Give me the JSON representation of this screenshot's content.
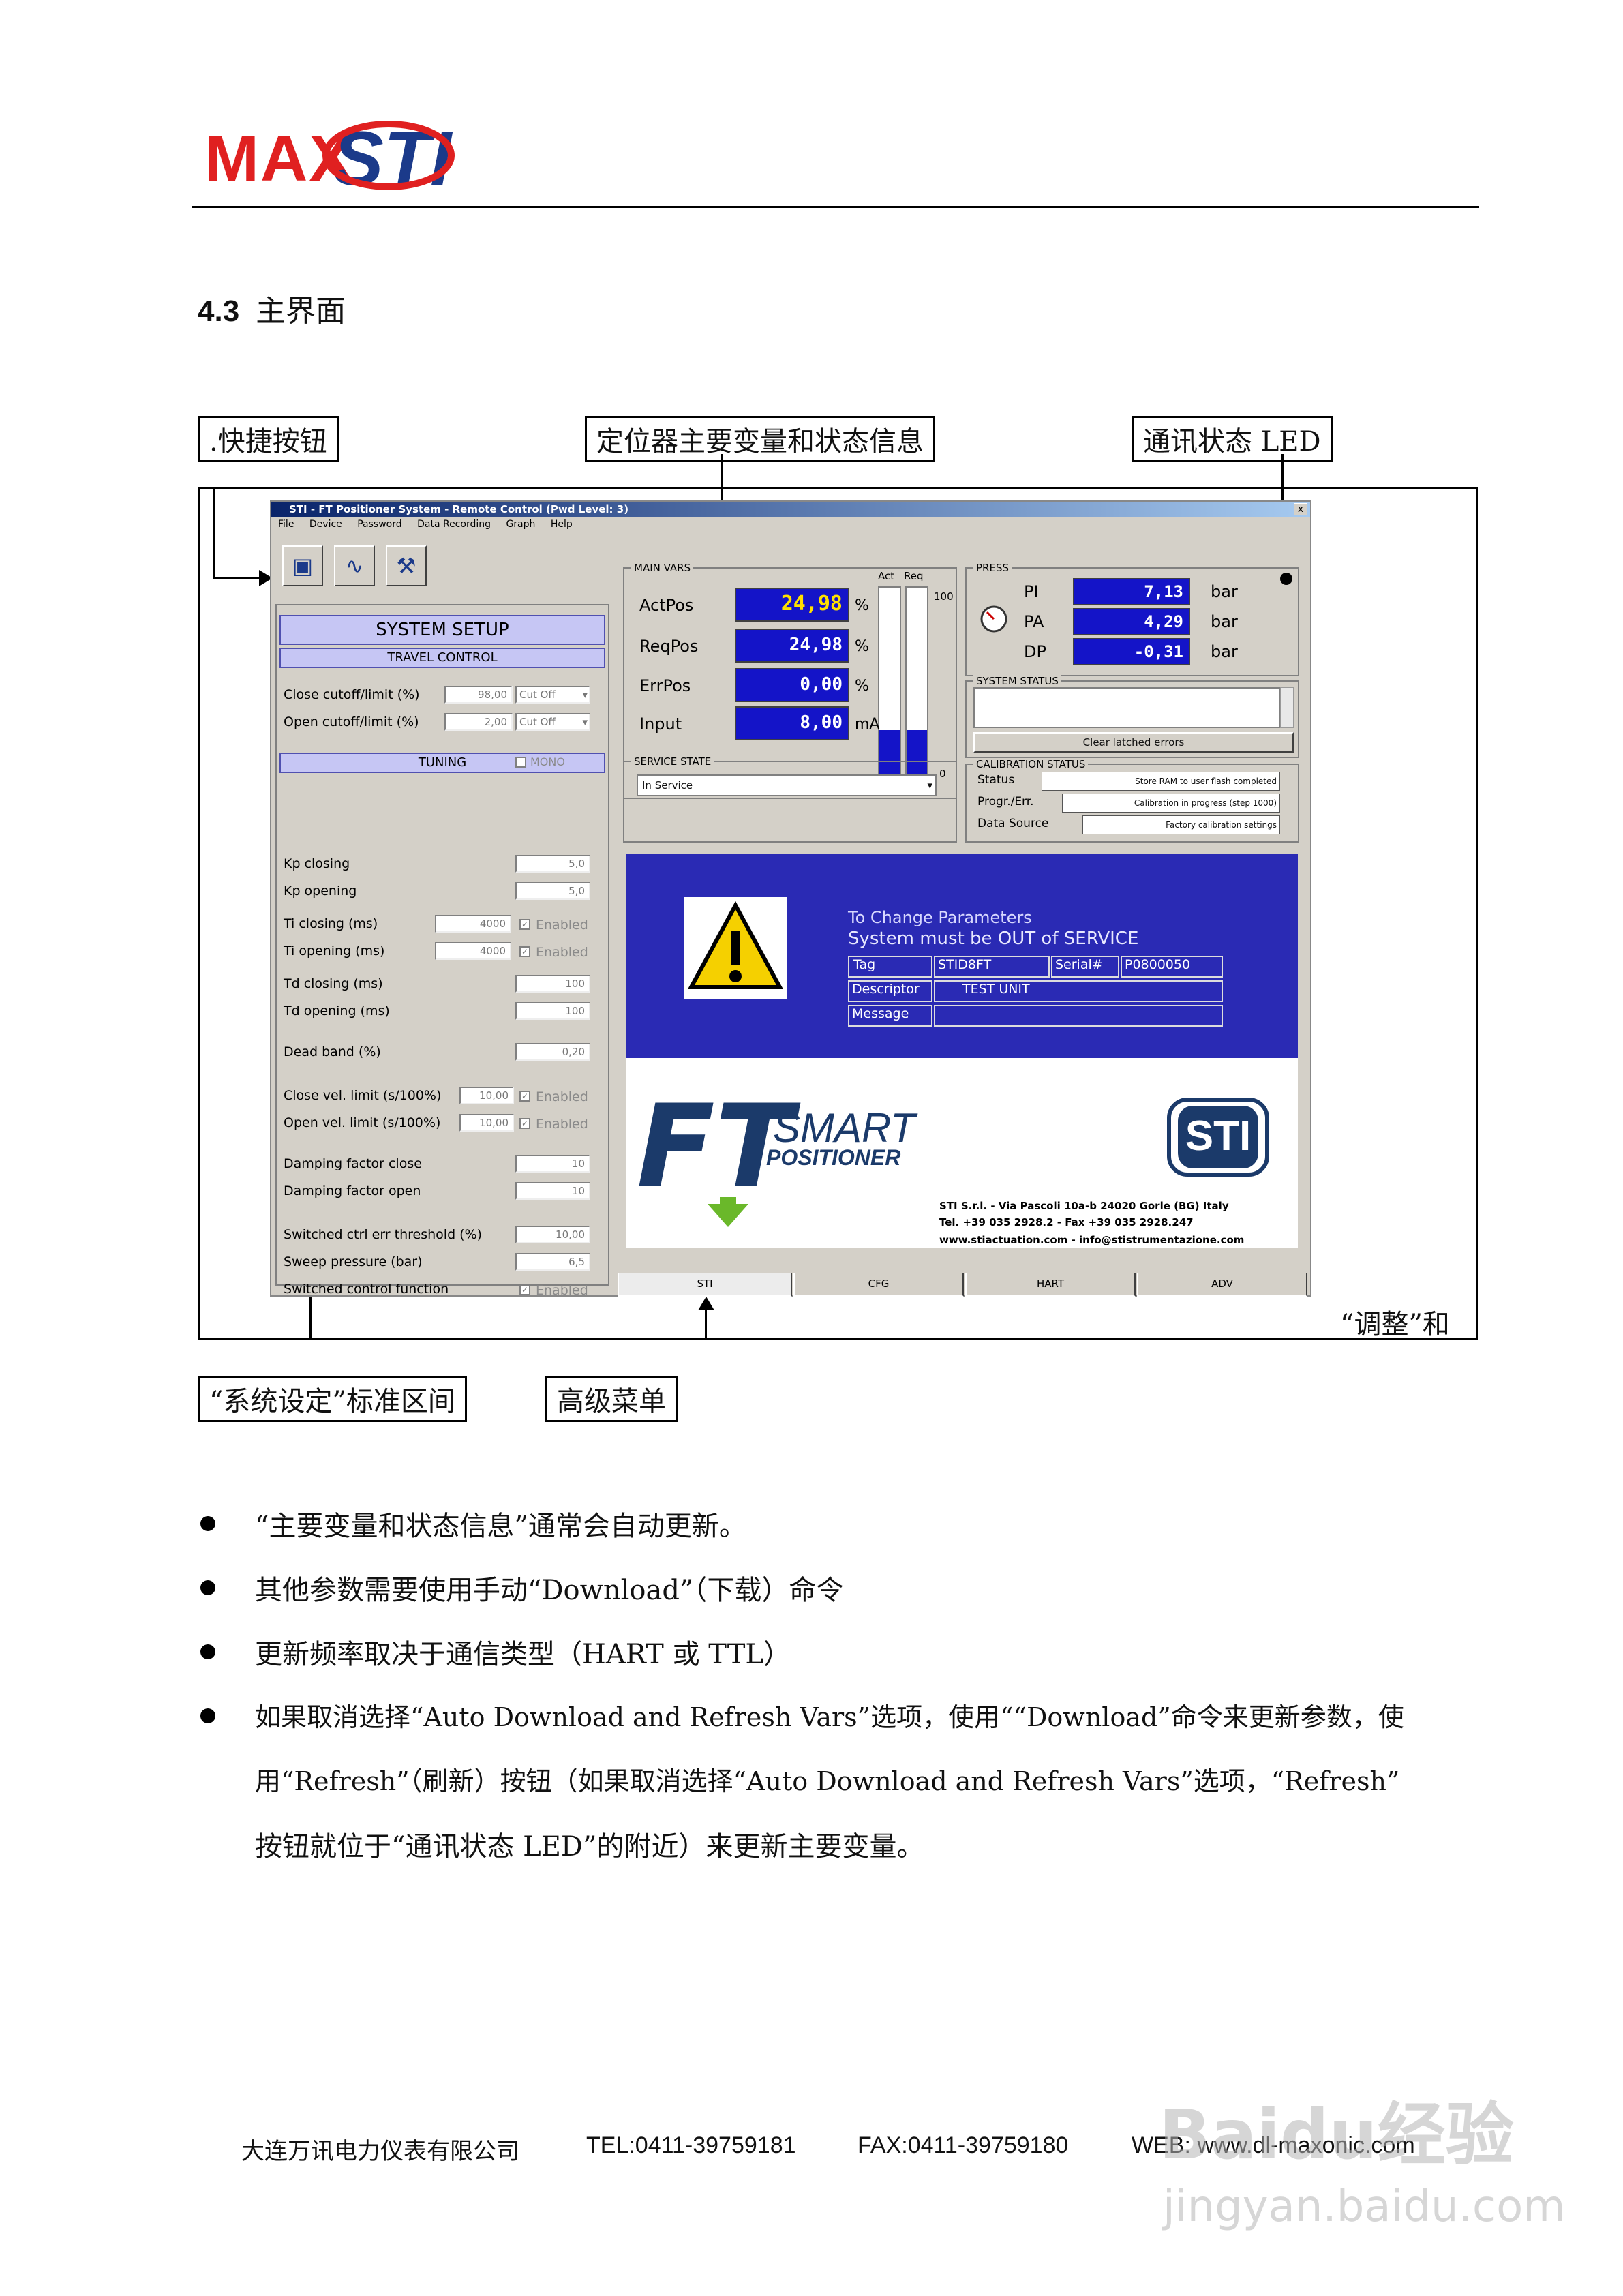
{
  "header": {
    "logo_left": "MAX",
    "logo_right": "STI"
  },
  "section": {
    "number": "4.3",
    "title": "主界面"
  },
  "callouts": {
    "shortcut": ".快捷按钮",
    "main_vars": "定位器主要变量和状态信息",
    "comm_led": "通讯状态 LED",
    "system_setup": "“系统设定”标准区间",
    "advanced_menu": "高级菜单",
    "adjust_and": "“调整”和"
  },
  "app": {
    "title": "STI - FT Positioner System - Remote Control   (Pwd Level: 3)",
    "close": "x",
    "menu": [
      "File",
      "Device",
      "Password",
      "Data Recording",
      "Graph",
      "Help"
    ],
    "system_setup": "SYSTEM SETUP",
    "travel_control": "TRAVEL CONTROL",
    "close_cutoff_label": "Close cutoff/limit (%)",
    "close_cutoff_value": "98,00",
    "close_cutoff_mode": "Cut Off",
    "open_cutoff_label": "Open cutoff/limit (%)",
    "open_cutoff_value": "2,00",
    "open_cutoff_mode": "Cut Off",
    "tuning": "TUNING",
    "tuning_check": "MONO",
    "params": [
      {
        "label": "Kp closing",
        "value": "5,0",
        "enabled": ""
      },
      {
        "label": "Kp opening",
        "value": "5,0",
        "enabled": ""
      },
      {
        "label": "Ti closing (ms)",
        "value": "4000",
        "enabled": "Enabled"
      },
      {
        "label": "Ti opening (ms)",
        "value": "4000",
        "enabled": "Enabled"
      },
      {
        "label": "Td closing (ms)",
        "value": "100",
        "enabled": ""
      },
      {
        "label": "Td opening (ms)",
        "value": "100",
        "enabled": ""
      },
      {
        "label": "Dead band (%)",
        "value": "0,20",
        "enabled": ""
      },
      {
        "label": "Close vel. limit (s/100%)",
        "value": "10,00",
        "enabled": "Enabled"
      },
      {
        "label": "Open  vel. limit (s/100%)",
        "value": "10,00",
        "enabled": "Enabled"
      },
      {
        "label": "Damping factor close",
        "value": "10",
        "enabled": ""
      },
      {
        "label": "Damping factor open",
        "value": "10",
        "enabled": ""
      },
      {
        "label": "Switched ctrl err threshold (%)",
        "value": "10,00",
        "enabled": ""
      },
      {
        "label": "Sweep pressure (bar)",
        "value": "6,5",
        "enabled": ""
      },
      {
        "label": "Switched control function",
        "value": "",
        "enabled": "Enabled"
      }
    ],
    "main_vars": {
      "title": "MAIN VARS",
      "act_label": "Act",
      "req_label": "Req",
      "scale_top": "100",
      "scale_bottom": "0",
      "rows": [
        {
          "label": "ActPos",
          "value": "24,98",
          "unit": "%"
        },
        {
          "label": "ReqPos",
          "value": "24,98",
          "unit": "%"
        },
        {
          "label": "ErrPos",
          "value": "0,00",
          "unit": "%"
        },
        {
          "label": "Input",
          "value": "8,00",
          "unit": "mA"
        }
      ],
      "act_fill_pct": 24.98,
      "req_fill_pct": 24.98
    },
    "press": {
      "title": "PRESS",
      "rows": [
        {
          "label": "PI",
          "value": "7,13",
          "unit": "bar"
        },
        {
          "label": "PA",
          "value": "4,29",
          "unit": "bar"
        },
        {
          "label": "DP",
          "value": "-0,31",
          "unit": "bar"
        }
      ]
    },
    "system_status": {
      "title": "SYSTEM STATUS",
      "button": "Clear latched errors"
    },
    "service_state": {
      "title": "SERVICE STATE",
      "value": "In Service"
    },
    "calibration": {
      "title": "CALIBRATION STATUS",
      "status_label": "Status",
      "status_value": "Store RAM to user flash completed",
      "progr_label": "Progr./Err.",
      "progr_value": "Calibration in progress (step 1000)",
      "source_label": "Data Source",
      "source_value": "Factory calibration settings"
    },
    "notice": {
      "line1": "To Change Parameters",
      "line2": "System must be OUT of SERVICE",
      "tag_label": "Tag",
      "tag_value": "STID8FT",
      "serial_label": "Serial#",
      "serial_value": "P0800050",
      "descriptor_label": "Descriptor",
      "descriptor_value": "TEST UNIT",
      "message_label": "Message",
      "message_value": ""
    },
    "brand": {
      "ft": "FT",
      "smart": "SMART",
      "positioner": "POSITIONER",
      "sti": "STI",
      "address1": "STI S.r.l. - Via Pascoli 10a-b 24020 Gorle (BG) Italy",
      "address2": "Tel. +39 035 2928.2 - Fax +39 035 2928.247",
      "address3": "www.stiactuation.com - info@stistrumentazione.com"
    },
    "tabs": [
      "STI",
      "CFG",
      "HART",
      "ADV"
    ]
  },
  "bullets": [
    "“主要变量和状态信息”通常会自动更新。",
    "其他参数需要使用手动“Download”（下载）命令",
    "更新频率取决于通信类型（HART 或 TTL）",
    "如果取消选择“Auto Download and Refresh Vars”选项，使用““Download”命令来更新参数，使",
    "用“Refresh”（刷新）按钮（如果取消选择“Auto Download and Refresh Vars”选项，“Refresh”",
    "按钮就位于“通讯状态 LED”的附近）来更新主要变量。"
  ],
  "footer": {
    "company": "大连万讯电力仪表有限公司",
    "tel": "TEL:0411-39759181",
    "fax": "FAX:0411-39759180",
    "web": "WEB: www.dl-maxonic.com"
  },
  "watermark": {
    "line1": "Baidu经验",
    "line2": "jingyan.baidu.com"
  },
  "colors": {
    "value_box": "#1414c8",
    "notice_bg": "#2a2ab4",
    "logo_red": "#e02020",
    "logo_blue": "#1b3a8a"
  }
}
